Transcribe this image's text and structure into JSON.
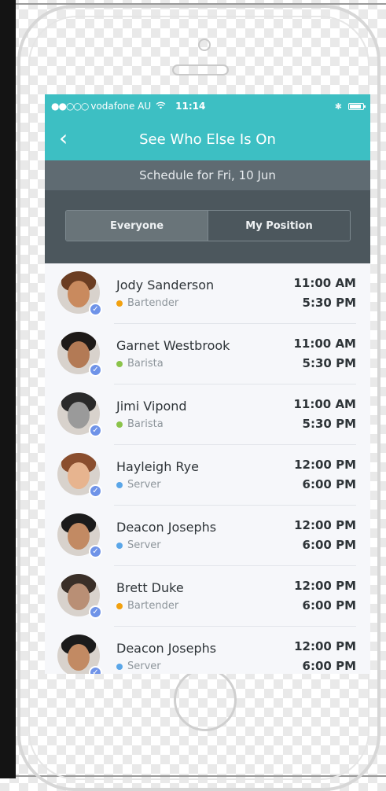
{
  "status_bar": {
    "signal": "●●○○○",
    "carrier": "vodafone AU",
    "wifi_icon": "wifi-icon",
    "time": "11:14",
    "bluetooth_icon": "bluetooth-icon",
    "battery_icon": "battery-icon"
  },
  "nav": {
    "back_glyph": "‹",
    "title": "See Who Else Is On"
  },
  "schedule_label": "Schedule for Fri, 10 Jun",
  "filters": {
    "selected": "Everyone",
    "options": [
      "Everyone",
      "My Position"
    ]
  },
  "colors": {
    "accent": "#3dbfc3",
    "bartender": "#f2a10f",
    "barista": "#8bc34a",
    "server": "#5aa6e8",
    "badge": "#6f93e8"
  },
  "staff": [
    {
      "name": "Jody Sanderson",
      "position": "Bartender",
      "start": "11:00 AM",
      "end": "5:30 PM",
      "dot_color": "#f2a10f",
      "skin": "#c98a5e",
      "hair": "#6b3d22"
    },
    {
      "name": "Garnet Westbrook",
      "position": "Barista",
      "start": "11:00 AM",
      "end": "5:30 PM",
      "dot_color": "#8bc34a",
      "skin": "#b37a55",
      "hair": "#1e1a18"
    },
    {
      "name": "Jimi Vipond",
      "position": "Barista",
      "start": "11:00 AM",
      "end": "5:30 PM",
      "dot_color": "#8bc34a",
      "skin": "#9a9a9a",
      "hair": "#2a2a2a"
    },
    {
      "name": "Hayleigh Rye",
      "position": "Server",
      "start": "12:00 PM",
      "end": "6:00 PM",
      "dot_color": "#5aa6e8",
      "skin": "#e7b48f",
      "hair": "#8a4e2e"
    },
    {
      "name": "Deacon Josephs",
      "position": "Server",
      "start": "12:00 PM",
      "end": "6:00 PM",
      "dot_color": "#5aa6e8",
      "skin": "#c28a63",
      "hair": "#1b1b1b"
    },
    {
      "name": "Brett Duke",
      "position": "Bartender",
      "start": "12:00 PM",
      "end": "6:00 PM",
      "dot_color": "#f2a10f",
      "skin": "#b98f75",
      "hair": "#3a2f28"
    },
    {
      "name": "Deacon Josephs",
      "position": "Server",
      "start": "12:00 PM",
      "end": "6:00 PM",
      "dot_color": "#5aa6e8",
      "skin": "#c28a63",
      "hair": "#1b1b1b"
    }
  ]
}
